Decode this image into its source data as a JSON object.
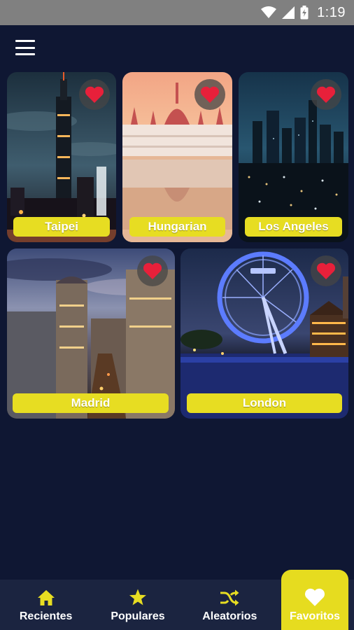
{
  "status_bar": {
    "time": "1:19"
  },
  "app_bar": {
    "menu_icon": "hamburger-menu-icon"
  },
  "cards": [
    {
      "label": "Taipei",
      "favorited": true
    },
    {
      "label": "Hungarian",
      "favorited": true
    },
    {
      "label": "Los Angeles",
      "favorited": true
    },
    {
      "label": "Madrid",
      "favorited": true
    },
    {
      "label": "London",
      "favorited": true
    }
  ],
  "bottom_nav": {
    "items": [
      {
        "label": "Recientes",
        "icon": "home-icon"
      },
      {
        "label": "Populares",
        "icon": "star-icon"
      },
      {
        "label": "Aleatorios",
        "icon": "shuffle-icon"
      },
      {
        "label": "Favoritos",
        "icon": "heart-icon"
      }
    ],
    "active_index": 3
  },
  "colors": {
    "background": "#0f1733",
    "accent_yellow": "#e7dd22",
    "heart_red": "#e8203a",
    "status_bar_gray": "#808080",
    "nav_background": "#1b2440"
  }
}
